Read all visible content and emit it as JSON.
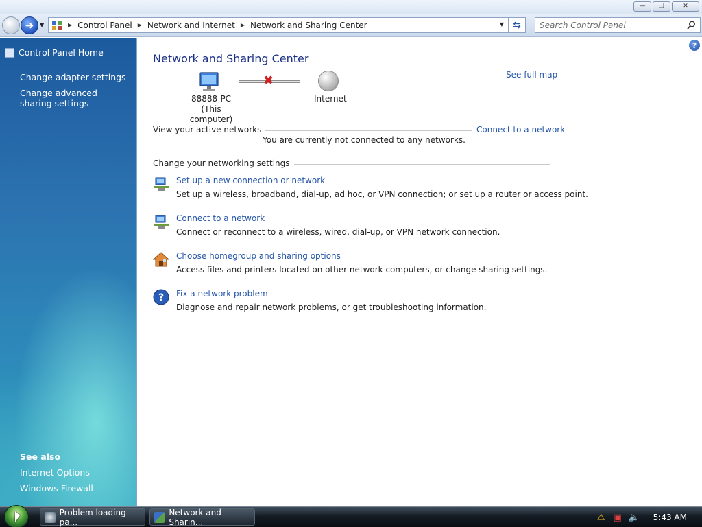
{
  "window": {
    "min_label": "—",
    "restore_label": "❐",
    "close_label": "✕"
  },
  "navbar": {
    "breadcrumbs": [
      "Control Panel",
      "Network and Internet",
      "Network and Sharing Center"
    ],
    "search_placeholder": "Search Control Panel"
  },
  "sidebar": {
    "home": "Control Panel Home",
    "links": [
      "Change adapter settings",
      "Change advanced sharing settings"
    ],
    "see_also_title": "See also",
    "see_also": [
      "Internet Options",
      "Windows Firewall"
    ]
  },
  "main": {
    "title": "Network and Sharing Center",
    "see_full_map": "See full map",
    "computer_name": "88888-PC",
    "computer_sub": "(This computer)",
    "internet_label": "Internet",
    "active_networks_heading": "View your active networks",
    "connect_link": "Connect to a network",
    "not_connected": "You are currently not connected to any networks.",
    "settings_heading": "Change your networking settings",
    "tasks": [
      {
        "link": "Set up a new connection or network",
        "desc": "Set up a wireless, broadband, dial-up, ad hoc, or VPN connection; or set up a router or access point.",
        "icon": "network-setup-icon"
      },
      {
        "link": "Connect to a network",
        "desc": "Connect or reconnect to a wireless, wired, dial-up, or VPN network connection.",
        "icon": "network-connect-icon"
      },
      {
        "link": "Choose homegroup and sharing options",
        "desc": "Access files and printers located on other network computers, or change sharing settings.",
        "icon": "homegroup-icon"
      },
      {
        "link": "Fix a network problem",
        "desc": "Diagnose and repair network problems, or get troubleshooting information.",
        "icon": "help-question-icon"
      }
    ]
  },
  "taskbar": {
    "buttons": [
      "Problem loading pa...",
      "Network and Sharin..."
    ],
    "clock": "5:43 AM"
  }
}
